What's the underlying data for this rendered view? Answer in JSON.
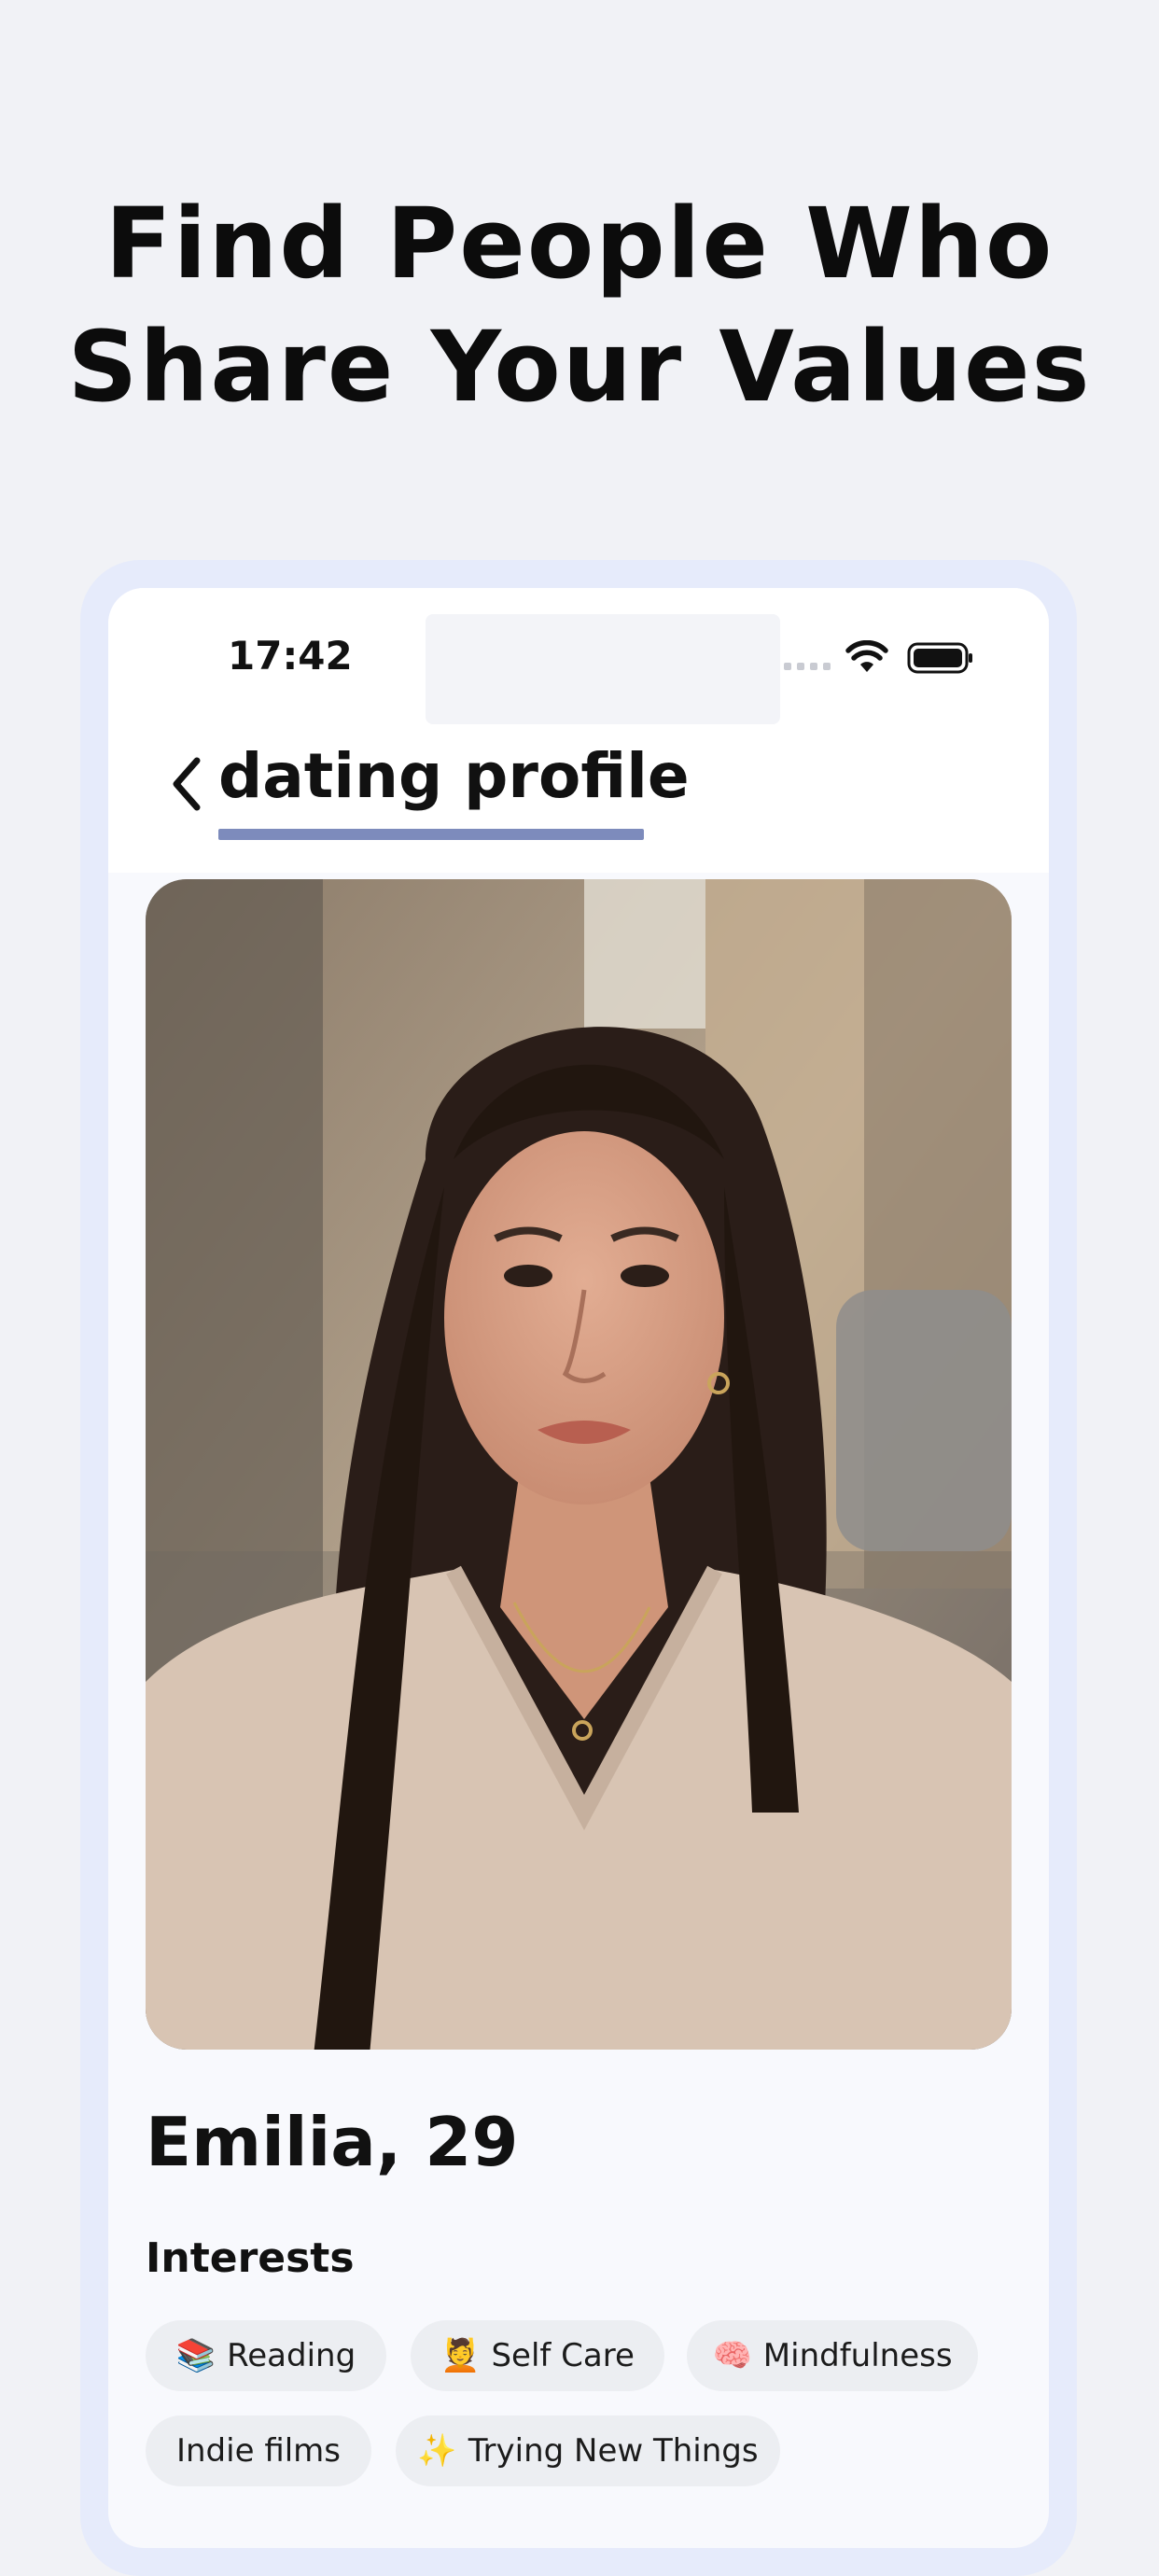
{
  "headline": {
    "line1": "Find People Who",
    "line2": "Share Your Values"
  },
  "status_bar": {
    "time": "17:42",
    "icons": [
      "cellular-signal-icon",
      "wifi-icon",
      "battery-icon"
    ]
  },
  "nav": {
    "back_icon": "chevron-left-icon",
    "title": "dating profile"
  },
  "profile": {
    "name_age": "Emilia, 29",
    "photo": "profile-photo"
  },
  "interests": {
    "title": "Interests",
    "chips": [
      {
        "emoji": "📚",
        "label": "Reading"
      },
      {
        "emoji": "💆",
        "label": "Self Care"
      },
      {
        "emoji": "🧠",
        "label": "Mindfulness"
      },
      {
        "emoji": "",
        "label": "Indie films"
      },
      {
        "emoji": "✨",
        "label": "Trying New Things"
      }
    ]
  },
  "colors": {
    "page_bg": "#f1f2f6",
    "frame": "#e6ebfb",
    "accent_underline": "#7d8bbc",
    "chip_bg": "#eceef2"
  }
}
